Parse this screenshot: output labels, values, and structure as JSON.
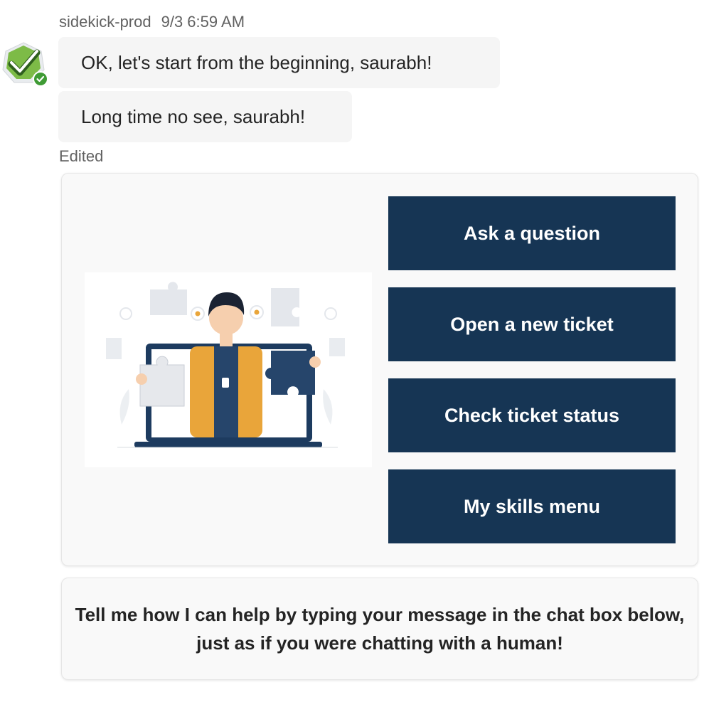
{
  "message": {
    "sender": "sidekick-prod",
    "timestamp": "9/3 6:59 AM",
    "bubbles": [
      "OK, let's start from the beginning, saurabh!",
      "Long time no see, saurabh!"
    ],
    "edited_label": "Edited"
  },
  "card": {
    "illustration": "person-holding-puzzle-pieces-illustration",
    "buttons": [
      "Ask a question",
      "Open a new ticket",
      "Check ticket status",
      "My skills menu"
    ]
  },
  "help_card": {
    "text": "Tell me how I can help by typing your message in the chat box below, just as if you were chatting with a human!"
  },
  "colors": {
    "button_bg": "#163554",
    "avatar_green": "#6fb33f",
    "status_green": "#3f9b35",
    "shirt_orange": "#e9a53a"
  },
  "icons": {
    "avatar": "checkmark-icon",
    "status": "available-check-icon"
  }
}
